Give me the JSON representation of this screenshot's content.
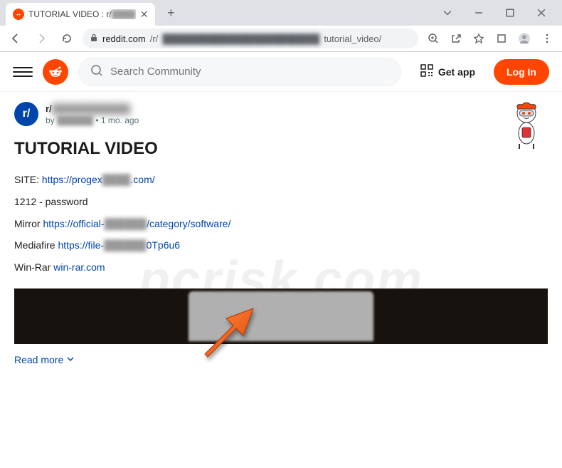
{
  "browser": {
    "tab_title": "TUTORIAL VIDEO : r/",
    "url_domain": "reddit.com",
    "url_path_prefix": "/r/",
    "url_path_suffix": "tutorial_video/"
  },
  "header": {
    "search_placeholder": "Search Community",
    "getapp_label": "Get app",
    "login_label": "Log In"
  },
  "post": {
    "subreddit_prefix": "r/",
    "byline_by": "by ",
    "byline_time": " • 1 mo. ago",
    "title": "TUTORIAL VIDEO",
    "site_label": "SITE: ",
    "site_link_a": "https://progex",
    "site_link_b": ".com/",
    "password_line": "1212 - password",
    "mirror_label": "Mirror ",
    "mirror_link_a": "https://official-",
    "mirror_link_b": "/category/software/",
    "mediafire_label": "Mediafire ",
    "mediafire_link_a": "https://file-",
    "mediafire_link_b": "0Tp6u6",
    "winrar_label": "Win-Rar ",
    "winrar_link": "win-rar.com",
    "readmore": "Read more"
  },
  "watermark": "pcrisk.com",
  "blurred_text": "██████"
}
